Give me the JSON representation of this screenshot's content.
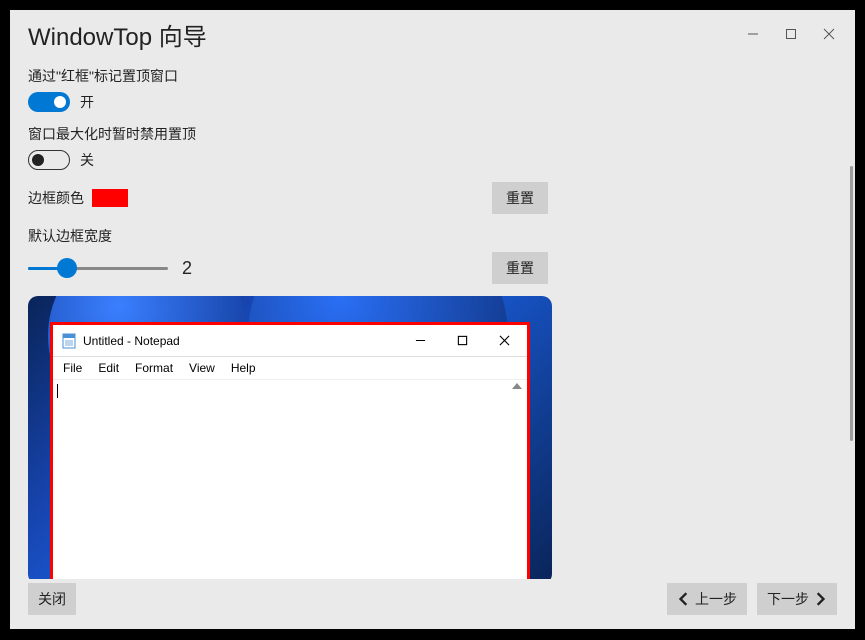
{
  "window": {
    "title": "WindowTop 向导"
  },
  "settings": {
    "mark_with_red_border": {
      "label": "通过\"红框\"标记置顶窗口",
      "state_label": "开",
      "enabled": true
    },
    "disable_on_maximize": {
      "label": "窗口最大化时暂时禁用置顶",
      "state_label": "关",
      "enabled": false
    },
    "border_color": {
      "label": "边框颜色",
      "value": "#ff0000",
      "reset_label": "重置"
    },
    "border_width": {
      "label": "默认边框宽度",
      "value": 2,
      "reset_label": "重置"
    }
  },
  "preview": {
    "notepad": {
      "title": "Untitled - Notepad",
      "menu": [
        "File",
        "Edit",
        "Format",
        "View",
        "Help"
      ]
    }
  },
  "footer": {
    "close": "关闭",
    "prev": "上一步",
    "next": "下一步"
  }
}
